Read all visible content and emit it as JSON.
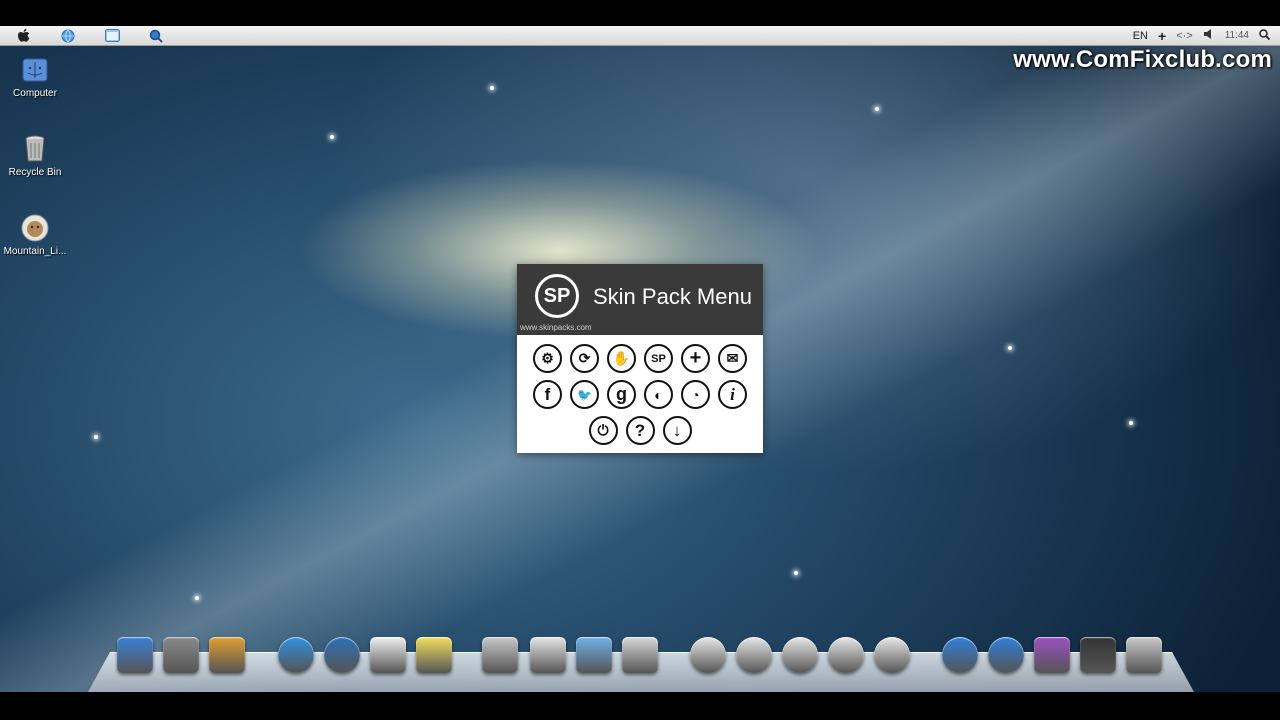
{
  "menubar": {
    "left_icons": [
      "apple-icon",
      "globe-icon",
      "finder-window-icon",
      "search-icon"
    ],
    "language": "EN",
    "clock": "11:44"
  },
  "watermark": "www.ComFixclub.com",
  "desktop_icons": [
    {
      "label": "Computer",
      "icon": "computer-icon"
    },
    {
      "label": "Recycle Bin",
      "icon": "recycle-bin-icon"
    },
    {
      "label": "Mountain_Li...",
      "icon": "mountain-lion-icon"
    }
  ],
  "skin_pack_menu": {
    "logo": "SP",
    "title": "Skin Pack Menu",
    "url": "www.skinpacks.com",
    "rows": [
      [
        {
          "icon": "settings-icon",
          "glyph": "⚙"
        },
        {
          "icon": "refresh-icon",
          "glyph": "⟳"
        },
        {
          "icon": "hand-icon",
          "glyph": "✋"
        },
        {
          "icon": "sp-icon",
          "glyph": "SP"
        },
        {
          "icon": "plus-icon",
          "glyph": "+"
        },
        {
          "icon": "mail-icon",
          "glyph": "✉"
        }
      ],
      [
        {
          "icon": "facebook-icon",
          "glyph": "f"
        },
        {
          "icon": "twitter-icon",
          "glyph": "🐦"
        },
        {
          "icon": "google-icon",
          "glyph": "g"
        },
        {
          "icon": "deviantart-icon",
          "glyph": "◐"
        },
        {
          "icon": "rss-icon",
          "glyph": "◔"
        },
        {
          "icon": "info-icon",
          "glyph": "i"
        }
      ],
      [
        {
          "icon": "power-icon",
          "glyph": "⏻"
        },
        {
          "icon": "help-icon",
          "glyph": "?"
        },
        {
          "icon": "download-icon",
          "glyph": "↓"
        }
      ]
    ]
  },
  "dock": {
    "items": [
      {
        "icon": "finder-icon",
        "color": "#3b7fd8"
      },
      {
        "icon": "system-preferences-icon",
        "color": "#8a8a8a"
      },
      {
        "icon": "app-grid-icon",
        "color": "#e0a030"
      },
      {
        "icon": "safari-icon",
        "color": "#2f8fe0"
      },
      {
        "icon": "quicktime-icon",
        "color": "#2e6fb8"
      },
      {
        "icon": "notes-list-icon",
        "color": "#f2f2f2"
      },
      {
        "icon": "stickies-icon",
        "color": "#f5e060"
      },
      {
        "icon": "app-store-alt-icon",
        "color": "#c8c8c8"
      },
      {
        "icon": "installer-icon",
        "color": "#e6e6e6"
      },
      {
        "icon": "applications-folder-icon",
        "color": "#6fb1e8"
      },
      {
        "icon": "share-icon",
        "color": "#d8d8d8"
      },
      {
        "icon": "icloud-icon",
        "color": "#e8e8e8"
      },
      {
        "icon": "twitter-icon",
        "color": "#e8e8e8"
      },
      {
        "icon": "airplay-icon",
        "color": "#e8e8e8"
      },
      {
        "icon": "rocket-icon",
        "color": "#e8e8e8"
      },
      {
        "icon": "power-icon",
        "color": "#e8e8e8"
      },
      {
        "icon": "itunes-icon",
        "color": "#2f7fd8"
      },
      {
        "icon": "app-store-icon",
        "color": "#2f7fd8"
      },
      {
        "icon": "mission-control-icon",
        "color": "#9a50c0"
      },
      {
        "icon": "qr-code-icon",
        "color": "#333333"
      },
      {
        "icon": "trash-icon",
        "color": "#c9c9c9"
      }
    ]
  },
  "colors": {
    "menubar": "#e6e6e6",
    "menu_header": "#3a3a3a",
    "menu_body": "#ffffff",
    "watermark": "#ffffff"
  }
}
